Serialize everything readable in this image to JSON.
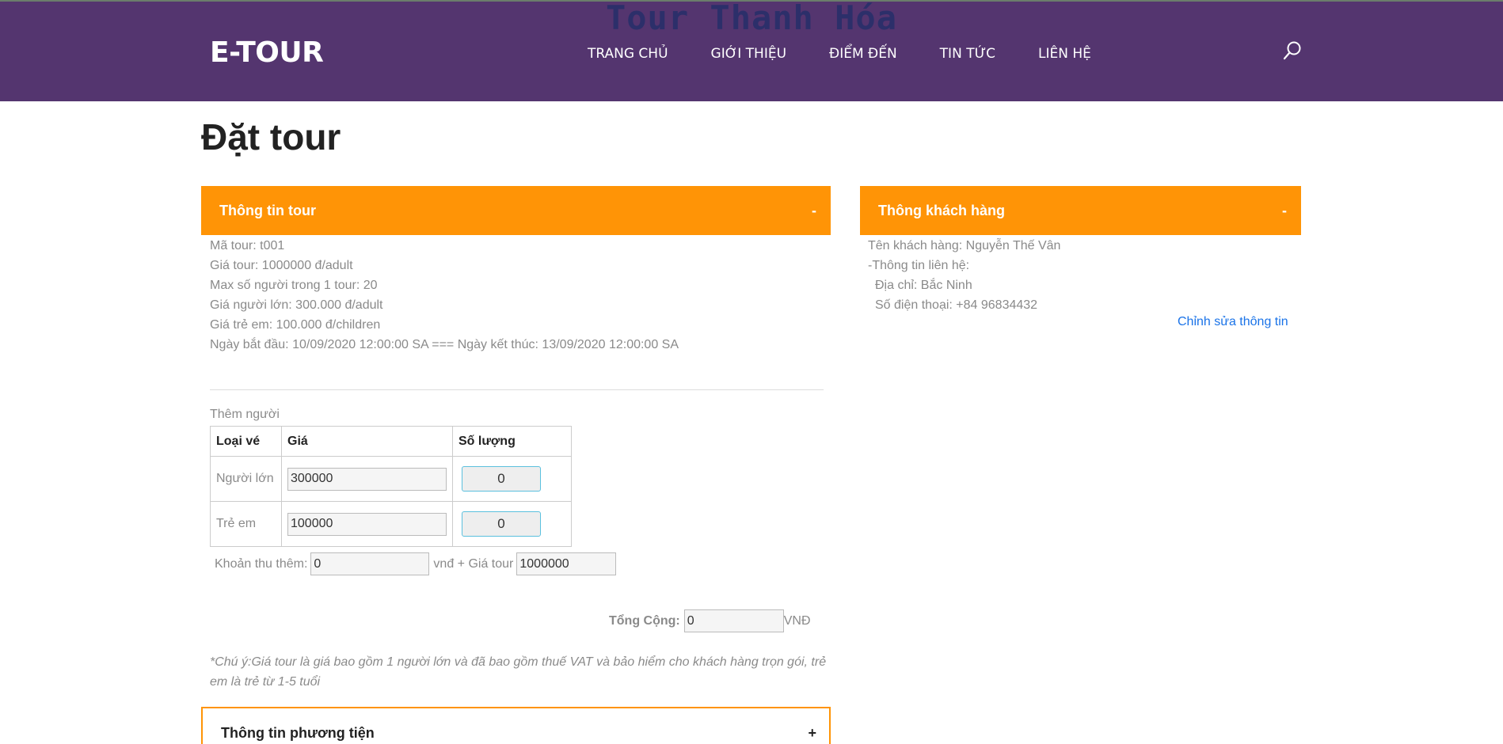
{
  "header": {
    "banner": "Tour Thanh Hóa",
    "logo": "E-TOUR",
    "nav": [
      "TRANG CHỦ",
      "GIỚI THIỆU",
      "ĐIỂM ĐẾN",
      "TIN TỨC",
      "LIÊN HỆ"
    ],
    "search_icon": "search-icon"
  },
  "page_title": "Đặt tour",
  "tour_panel": {
    "title": "Thông tin tour",
    "toggle": "-",
    "lines": [
      "Mã tour: t001",
      "Giá tour: 1000000 đ/adult",
      "Max số người trong 1 tour: 20",
      "Giá người lớn: 300.000 đ/adult",
      "Giá trẻ em: 100.000 đ/children",
      "Ngày bắt đầu: 10/09/2020 12:00:00 SA === Ngày kết thúc: 13/09/2020 12:00:00 SA"
    ]
  },
  "customer_panel": {
    "title": "Thông khách hàng",
    "toggle": "-",
    "name_line": "Tên khách hàng: Nguyễn Thế Vân",
    "contact_heading": "-Thông tin liên hệ:",
    "address_line": "Địa chỉ: Bắc Ninh",
    "phone_line": "Số điện thoại: +84 96834432",
    "edit_link": "Chỉnh sửa thông tin"
  },
  "add_people": {
    "label": "Thêm người",
    "headers": [
      "Loại vé",
      "Giá",
      "Số lượng"
    ],
    "rows": [
      {
        "type": "Người lớn",
        "price": "300000",
        "qty": "0"
      },
      {
        "type": "Trẻ em",
        "price": "100000",
        "qty": "0"
      }
    ]
  },
  "extra": {
    "label": "Khoản thu thêm:",
    "value": "0",
    "mid_label": "vnđ + Giá tour",
    "tour_price": "1000000"
  },
  "total": {
    "label": "Tổng Cộng:",
    "value": "0",
    "unit": "VNĐ"
  },
  "note": "*Chú ý:Giá tour là giá bao gồm 1 người lớn và đã bao gồm thuế VAT và bảo hiểm cho khách hàng trọn gói, trẻ em là trẻ từ 1-5 tuổi",
  "vehicle_panel": {
    "title": "Thông tin phương tiện",
    "toggle": "+"
  },
  "colors": {
    "header_bg": "#54356f",
    "panel_accent": "#ff9406",
    "link": "#1a73e8"
  }
}
